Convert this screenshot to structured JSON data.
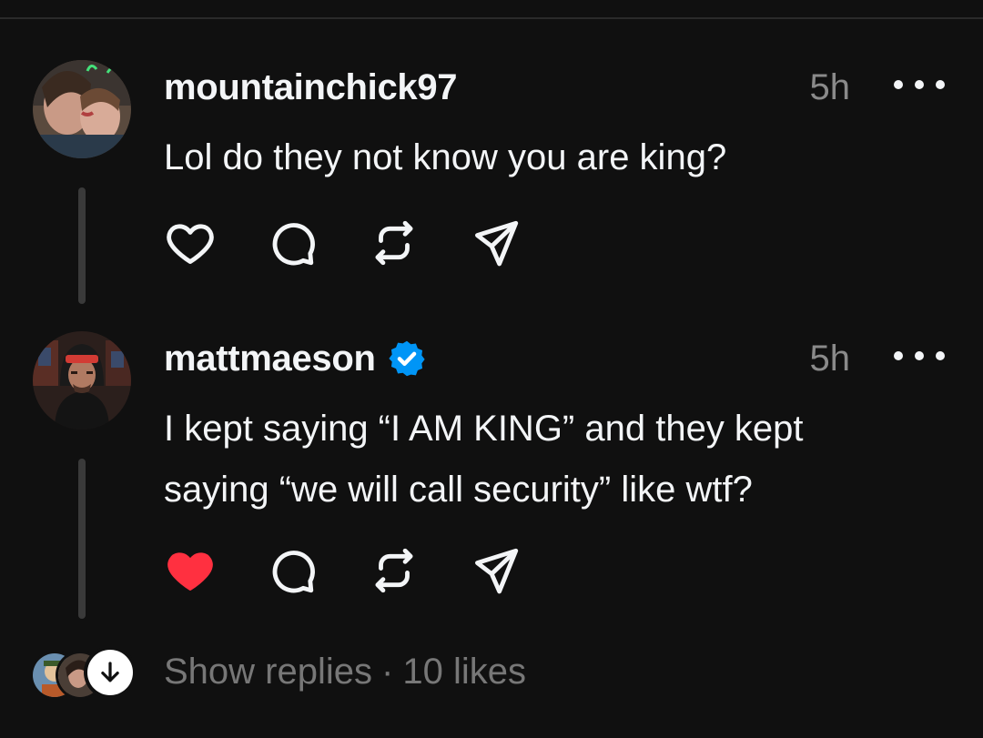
{
  "comments": [
    {
      "username": "mountainchick97",
      "verified": false,
      "time": "5h",
      "lines": [
        "Lol do they not know you are king?"
      ],
      "liked": false,
      "avatar_icon": "two-people-selfie-avatar"
    },
    {
      "username": "mattmaeson",
      "verified": true,
      "time": "5h",
      "lines": [
        "I kept saying “I AM KING” and they kept",
        "saying “we will call security” like wtf?"
      ],
      "liked": true,
      "avatar_icon": "man-in-red-headband-avatar"
    }
  ],
  "footer": {
    "show_replies": "Show replies",
    "separator": "·",
    "likes": "10 likes"
  },
  "icons": {
    "like": "heart-icon",
    "comment": "comment-icon",
    "repost": "repost-icon",
    "share": "share-icon",
    "more": "more-options-icon",
    "expand": "arrow-down-icon",
    "verified": "verified-badge-icon"
  },
  "colors": {
    "background": "#101010",
    "text": "#f3f5f7",
    "muted": "#8a8a8a",
    "liked_heart": "#ff3040",
    "verified_blue": "#0095f6"
  }
}
